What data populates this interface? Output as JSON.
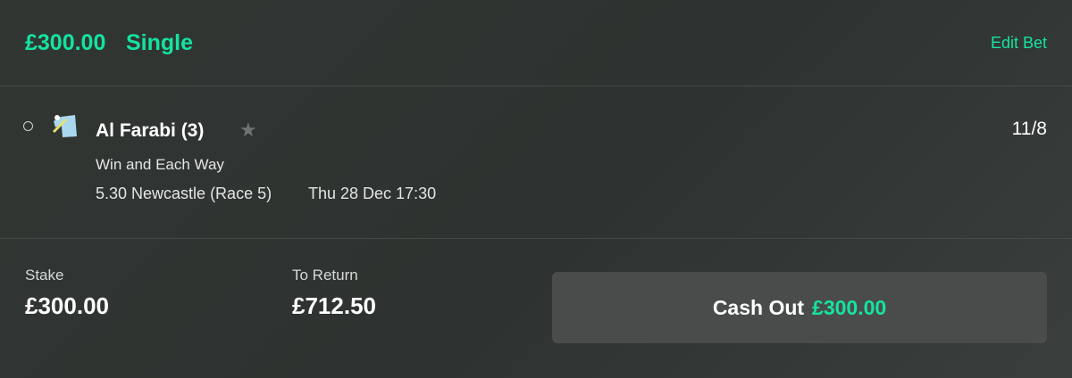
{
  "header": {
    "amount": "£300.00",
    "bet_type": "Single",
    "edit_label": "Edit Bet"
  },
  "selection": {
    "runner_name": "Al Farabi (3)",
    "odds": "11/8",
    "market": "Win and Each Way",
    "event": "5.30 Newcastle (Race 5)",
    "event_datetime": "Thu 28 Dec 17:30",
    "icons": {
      "radio": "radio-circle-icon",
      "silks": "jockey-silks-icon",
      "favourite": "star-icon"
    }
  },
  "footer": {
    "stake_label": "Stake",
    "stake_value": "£300.00",
    "return_label": "To Return",
    "return_value": "£712.50",
    "cashout_label": "Cash Out",
    "cashout_value": "£300.00"
  },
  "colors": {
    "accent": "#14e3a1",
    "background": "#313633",
    "button": "#4a4c4b",
    "divider": "#454a47"
  }
}
